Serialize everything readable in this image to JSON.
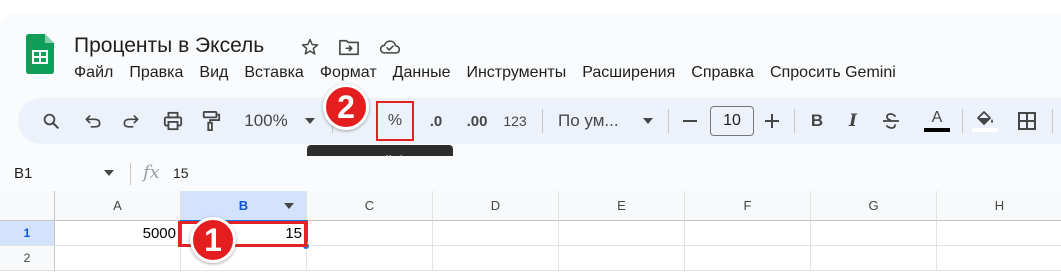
{
  "app": {
    "title": "Проценты в Эксель",
    "menu": [
      "Файл",
      "Правка",
      "Вид",
      "Вставка",
      "Формат",
      "Данные",
      "Инструменты",
      "Расширения",
      "Справка",
      "Спросить Gemini"
    ]
  },
  "toolbar": {
    "zoom": "100%",
    "percent_label": "%",
    "decrease_decimal_label": ".0",
    "increase_decimal_label": ".00",
    "number_format_label": "123",
    "font_name": "По ум...",
    "font_size": "10",
    "bold_label": "B",
    "italic_label": "I",
    "text_color_label": "A",
    "tooltip": "Процентный формат"
  },
  "annotations": {
    "badge_1": "1",
    "badge_2": "2",
    "accent_color": "#e41e1e"
  },
  "formula_bar": {
    "cell_ref": "B1",
    "fx": "fx",
    "value": "15"
  },
  "grid": {
    "columns": [
      "A",
      "B",
      "C",
      "D",
      "E",
      "F",
      "G",
      "H"
    ],
    "rows": [
      "1",
      "2"
    ],
    "cells": {
      "A1": "5000",
      "B1": "15"
    },
    "selected_cell": "B1",
    "selection_color": "#1a73e8"
  }
}
